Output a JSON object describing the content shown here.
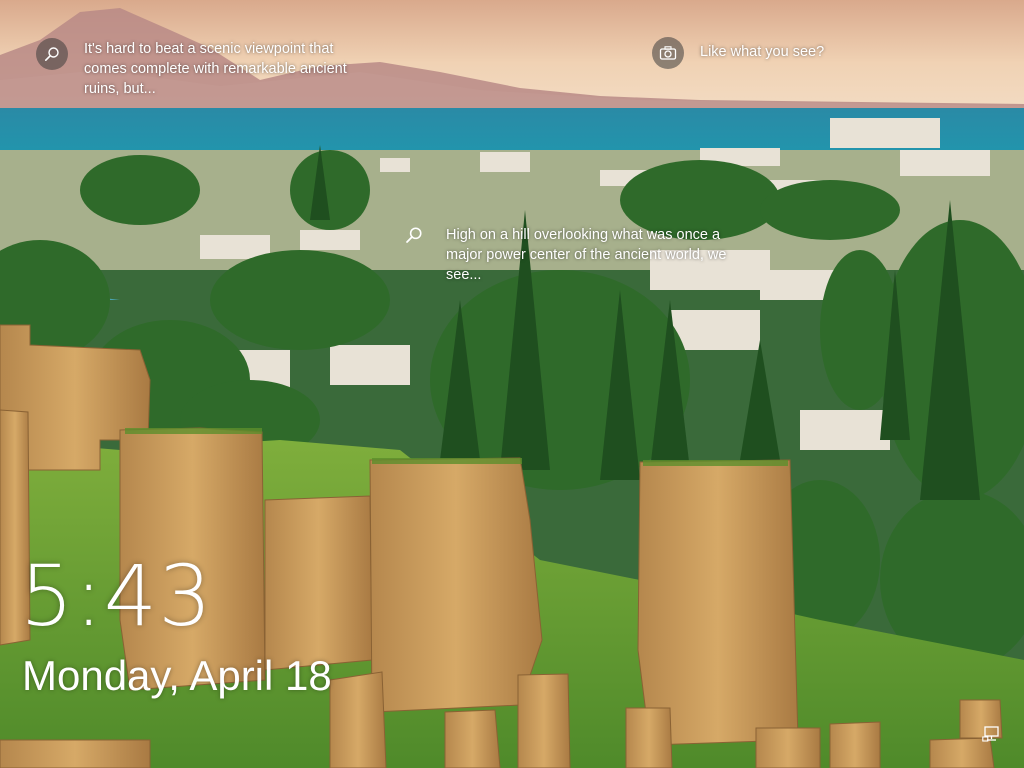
{
  "lockscreen": {
    "spotlight": {
      "hotspot_top": {
        "icon": "search-icon",
        "text": "It's hard to beat a scenic viewpoint that comes complete with remarkable ancient ruins, but..."
      },
      "like_prompt": {
        "icon": "camera-icon",
        "text": "Like what you see?"
      },
      "hotspot_middle": {
        "icon": "search-icon",
        "text": "High on a hill overlooking what was once a major power center of the ancient world, we see..."
      }
    },
    "time": "5:43",
    "date": "Monday, April 18",
    "tray": {
      "icon": "network-icon"
    }
  },
  "colors": {
    "text": "#ffffff",
    "icon_circle": "rgba(60,60,60,0.55)",
    "sky": "#e8c7a8",
    "sea": "#1f8fa8",
    "foliage": "#3f7a2e",
    "stone": "#c99a5a"
  }
}
